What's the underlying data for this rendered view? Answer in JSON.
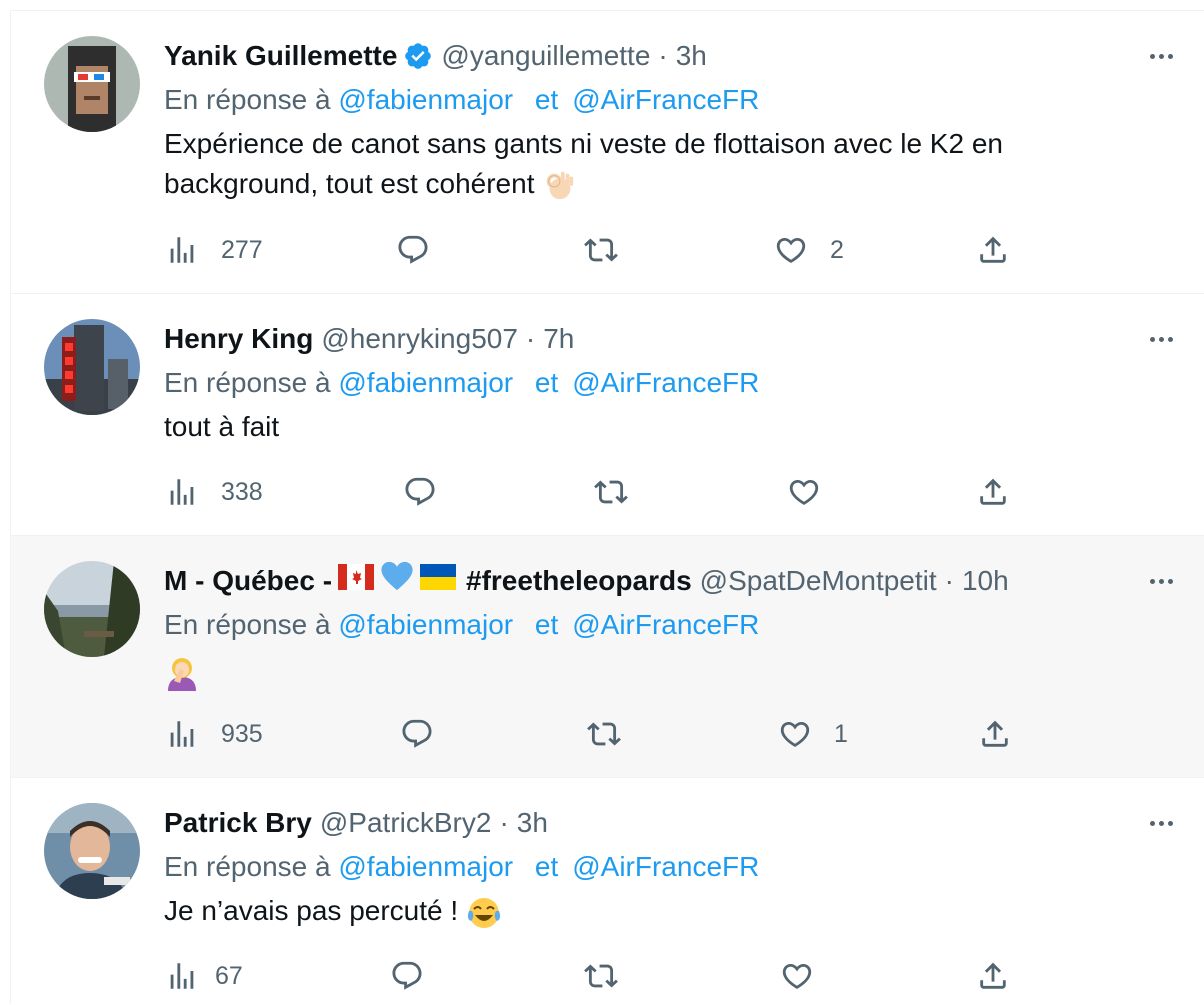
{
  "tweets": [
    {
      "name": "Yanik Guillemette",
      "handle": "@yanguillemette",
      "time": "3h",
      "reply_prefix": "En réponse à",
      "mention1": "@fabienmajor",
      "conj": "et",
      "mention2": "@AirFranceFR",
      "text_line1": "Expérience de canot sans gants ni veste de flottaison avec le K2 en",
      "text_line2": "background, tout est cohérent",
      "emoji": "ok-hand-emoji",
      "views": "277",
      "replies": "",
      "retweets": "",
      "likes": "2",
      "verified": true
    },
    {
      "name": "Henry King",
      "handle": "@henryking507",
      "time": "7h",
      "reply_prefix": "En réponse à",
      "mention1": "@fabienmajor",
      "conj": "et",
      "mention2": "@AirFranceFR",
      "text": "tout à fait",
      "views": "338",
      "replies": "",
      "retweets": "",
      "likes": ""
    },
    {
      "name_prefix": "M - Québec -",
      "name_suffix": "#freetheleopards",
      "name_emojis": [
        "canada-flag-emoji",
        "blue-heart-emoji",
        "ukraine-flag-emoji"
      ],
      "handle": "@SpatDeMontpetit",
      "time": "10h",
      "reply_prefix": "En réponse à",
      "mention1": "@fabienmajor",
      "conj": "et",
      "mention2": "@AirFranceFR",
      "emoji": "facepalm-emoji",
      "views": "935",
      "replies": "",
      "retweets": "",
      "likes": "1"
    },
    {
      "name": "Patrick Bry",
      "handle": "@PatrickBry2",
      "time": "3h",
      "reply_prefix": "En réponse à",
      "mention1": "@fabienmajor",
      "conj": "et",
      "mention2": "@AirFranceFR",
      "text": "Je n’avais pas percuté !",
      "emoji": "tears-of-joy-emoji",
      "views": "67",
      "replies": "",
      "retweets": "",
      "likes": ""
    }
  ],
  "separator": "·",
  "colors": {
    "link": "#1d9bf0",
    "secondary": "#536471",
    "primary": "#0f1419",
    "hover_bg": "#f7f7f7",
    "border": "#eff3f4"
  }
}
